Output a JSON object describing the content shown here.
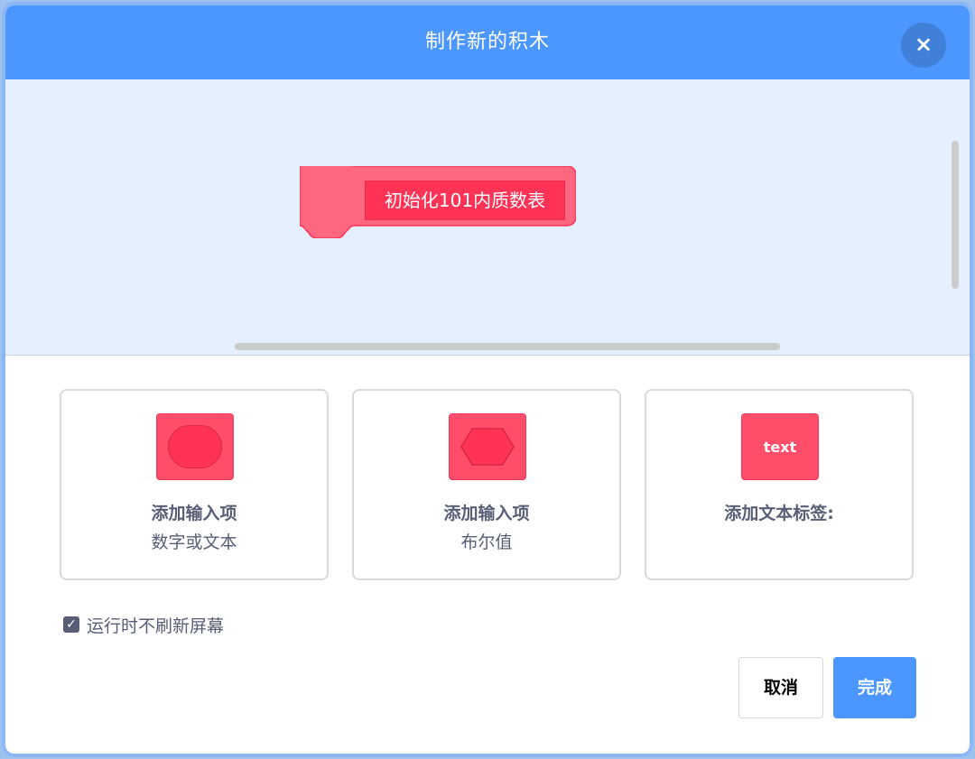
{
  "dialog": {
    "title": "制作新的积木",
    "close_icon": "close-icon"
  },
  "workspace": {
    "block_label": "初始化101内质数表",
    "block_color": "#ff3355"
  },
  "options": [
    {
      "icon": "number-or-text-input-icon",
      "title": "添加输入项",
      "subtitle": "数字或文本"
    },
    {
      "icon": "boolean-input-icon",
      "title": "添加输入项",
      "subtitle": "布尔值"
    },
    {
      "icon_text": "text",
      "title": "添加文本标签:"
    }
  ],
  "run_without_refresh": {
    "label": "运行时不刷新屏幕",
    "checked": true
  },
  "buttons": {
    "cancel": "取消",
    "ok": "完成"
  },
  "colors": {
    "accent": "#4c97ff",
    "workspace_bg": "#e5f0ff",
    "block_fill": "#ff4d6a",
    "text_muted": "#575e75"
  }
}
